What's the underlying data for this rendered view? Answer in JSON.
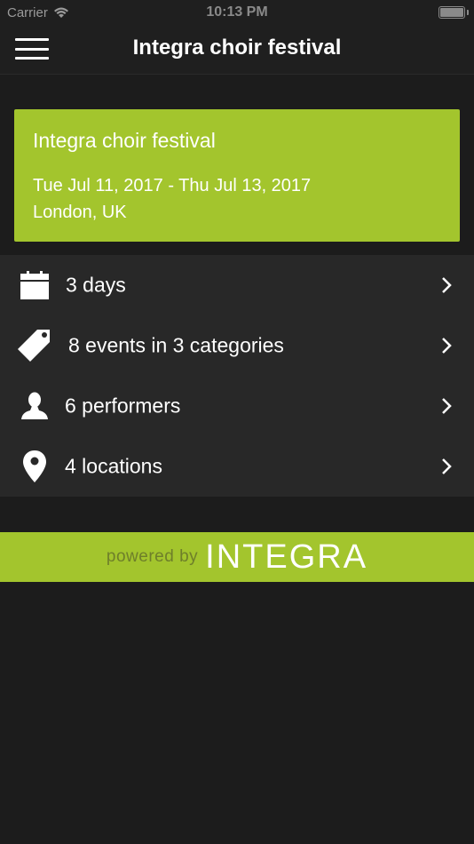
{
  "status_bar": {
    "carrier": "Carrier",
    "time": "10:13 PM"
  },
  "nav": {
    "title": "Integra choir festival",
    "menu_icon": "hamburger-menu-icon"
  },
  "event": {
    "name": "Integra choir festival",
    "dates": "Tue Jul 11, 2017 - Thu Jul 13, 2017",
    "location": "London, UK"
  },
  "list": {
    "items": [
      {
        "label": "3 days",
        "icon": "calendar-icon"
      },
      {
        "label": "8 events in 3 categories",
        "icon": "tag-icon"
      },
      {
        "label": "6 performers",
        "icon": "person-icon"
      },
      {
        "label": "4 locations",
        "icon": "location-pin-icon"
      }
    ]
  },
  "footer": {
    "powered_by": "powered by",
    "brand": "INTEGRA"
  },
  "colors": {
    "accent": "#a3c52d",
    "background": "#1c1c1c",
    "list_background": "#282828"
  }
}
